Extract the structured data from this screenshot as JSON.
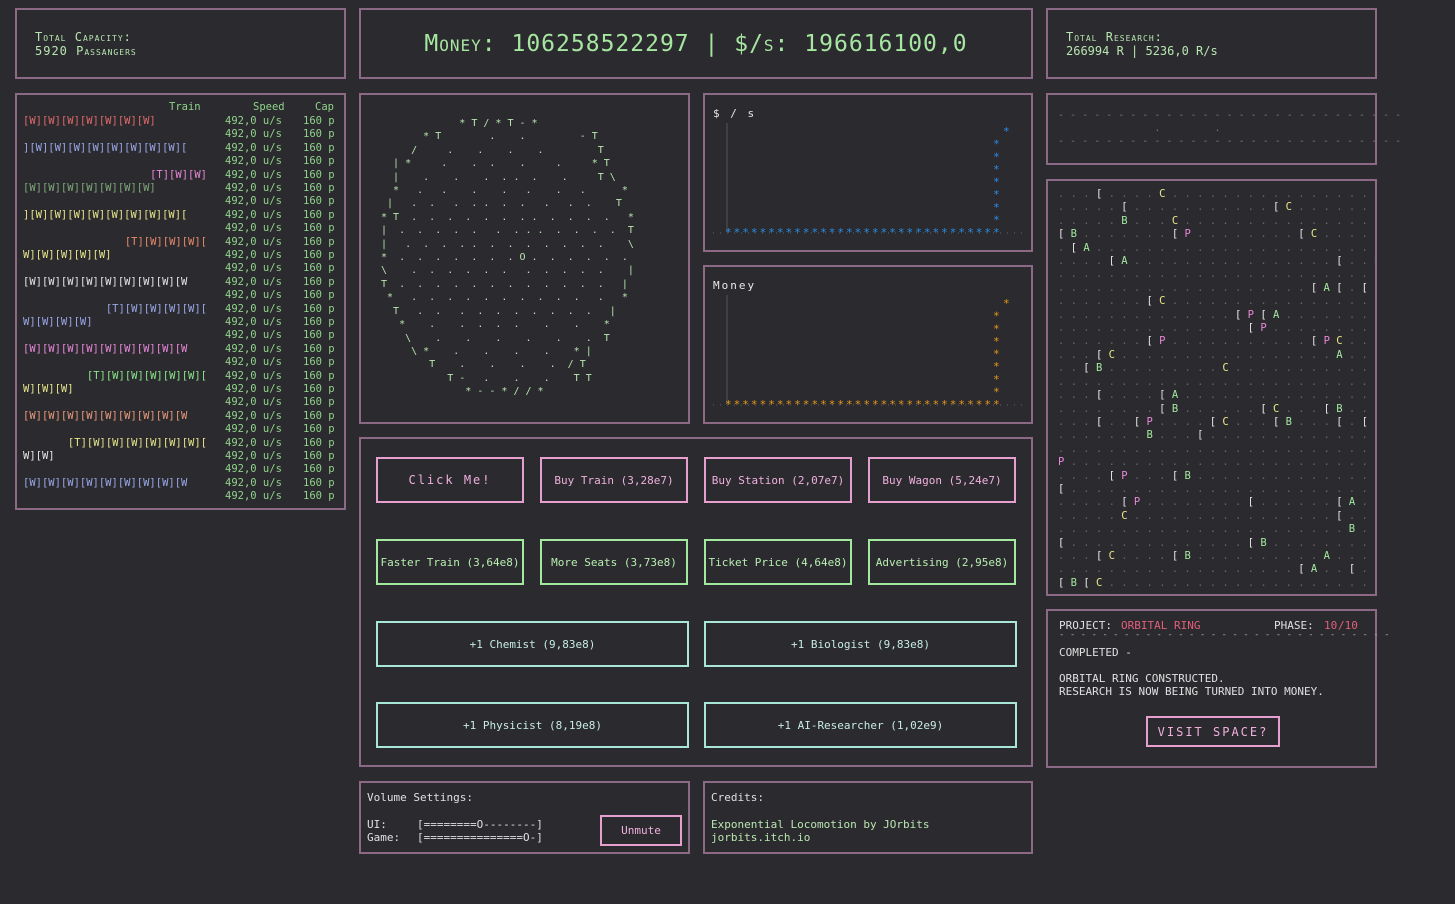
{
  "header": {
    "capacity_label": "Total Capacity:",
    "capacity_value": "5920 Passangers",
    "money_label": "Money:",
    "money_value": "106258522297",
    "separator": "|",
    "rate_label": "$/s:",
    "rate_value": "196616100,0",
    "research_label": "Total Research:",
    "research_value": "266994 R  |  5236,0 R/s"
  },
  "trains": {
    "headers": {
      "train": "Train",
      "speed": "Speed",
      "cap": "Cap"
    },
    "rows": [
      {
        "cars": "[W][W][W][W][W][W][W]",
        "align": "left",
        "color": "#e06a6a"
      },
      {
        "cars": "",
        "color": "#e06a6a"
      },
      {
        "cars": "][W][W][W][W][W][W][W][W][",
        "align": "left",
        "color": "#9aa8e8"
      },
      {
        "cars": "",
        "color": "#9aa8e8"
      },
      {
        "cars": "[T][W][W]",
        "align": "right",
        "color": "#e888d8"
      },
      {
        "cars": "[W][W][W][W][W][W][W]",
        "align": "left",
        "color": "#7ea87a"
      },
      {
        "cars": "",
        "color": "#7ea87a"
      },
      {
        "cars": "][W][W][W][W][W][W][W][W][",
        "align": "left",
        "color": "#e6e68a"
      },
      {
        "cars": "",
        "color": "#e6e68a"
      },
      {
        "cars": "[T][W][W][W][",
        "align": "right",
        "color": "#e88a6a"
      },
      {
        "cars": "W][W][W][W][W]",
        "align": "left",
        "color": "#e6e68a"
      },
      {
        "cars": "",
        "color": "#e6e68a"
      },
      {
        "cars": "[W][W][W][W][W][W][W][W][W",
        "align": "left",
        "color": "#e6e6e6"
      },
      {
        "cars": "",
        "color": "#e6e6e6"
      },
      {
        "cars": "[T][W][W][W][W][",
        "align": "right",
        "color": "#9aa8e8"
      },
      {
        "cars": "W][W][W][W]",
        "align": "left",
        "color": "#9aa8e8"
      },
      {
        "cars": "",
        "color": "#9aa8e8"
      },
      {
        "cars": "[W][W][W][W][W][W][W][W][W",
        "align": "left",
        "color": "#e888d8"
      },
      {
        "cars": "",
        "color": "#e888d8"
      },
      {
        "cars": "[T][W][W][W][W][W][",
        "align": "right",
        "color": "#8ae888"
      },
      {
        "cars": "W][W][W]",
        "align": "left",
        "color": "#e6e68a"
      },
      {
        "cars": "",
        "color": "#e6e68a"
      },
      {
        "cars": "[W][W][W][W][W][W][W][W][W",
        "align": "left",
        "color": "#e89a7a"
      },
      {
        "cars": "",
        "color": "#e89a7a"
      },
      {
        "cars": "[T][W][W][W][W][W][W][",
        "align": "right",
        "color": "#e6e68a"
      },
      {
        "cars": "W][W]",
        "align": "left",
        "color": "#e6e6e6"
      },
      {
        "cars": "",
        "color": "#e6e6e6"
      },
      {
        "cars": "[W][W][W][W][W][W][W][W][W",
        "align": "left",
        "color": "#9aa8e8"
      },
      {
        "cars": "",
        "color": "#9aa8e8"
      }
    ],
    "speed": "492,0 u/s",
    "cap": "160 p"
  },
  "globe": {
    "ascii": "              * T / * T - *\n        * T        .    .         - T\n      /     .    .    .    .         T\n   | *     .    .  .    .     .     * T\n   |    .    .    .  . .  .    .     T \\\n   *   .   .    .    .   .    .   .      *\n  |   .  .   .  . .  .  .   .   .  .    T\n * T  .  .  .  .  .  .  . .  .  .  .  .   *\n |  .  .  .  .  .   .  . . .  .  .  .  .  T\n |   .  .  .  . .  .  .  .  .  .  .  .    \\\n *  .  .  .  .  .  .  . O .  .  .  .  .  .\n \\    .  .  .  .  .  .   .  .  .  .  .    |\n T  .  .  .  .  .  .  .  .  .  .  .  .   |\n  *   .  .  .  .  .  .  .  .  .  .   .   *\n   T   .  .   .  .  .  .  .  .  .  .   |\n    *    .    .  .  .  .    .    .    *\n     \\    .    .    .    .    .    .  T\n      \\ *    .    .    .    .    * |\n         T    .    .    .    .  / T\n            T -   .    .    .    T T\n               * - - * / / *"
  },
  "chart_data": [
    {
      "type": "scatter",
      "title": "$ / s",
      "x": [
        1,
        2,
        3,
        4,
        5,
        6,
        7,
        8,
        9,
        10,
        11,
        12,
        13,
        14,
        15,
        16,
        17,
        18,
        19,
        20,
        21,
        22,
        23,
        24,
        25,
        26,
        27,
        28,
        29,
        30,
        31,
        32
      ],
      "values": [
        0,
        0,
        0,
        0,
        0,
        0,
        0,
        0,
        0,
        0,
        0,
        0,
        0,
        0,
        0,
        0,
        0,
        0,
        0,
        0,
        0,
        0,
        0,
        0,
        0,
        0,
        0,
        0,
        0,
        0,
        0,
        196616100
      ],
      "color": "#2a8fe8"
    },
    {
      "type": "scatter",
      "title": "Money",
      "x": [
        1,
        2,
        3,
        4,
        5,
        6,
        7,
        8,
        9,
        10,
        11,
        12,
        13,
        14,
        15,
        16,
        17,
        18,
        19,
        20,
        21,
        22,
        23,
        24,
        25,
        26,
        27,
        28,
        29,
        30,
        31,
        32
      ],
      "values": [
        0,
        0,
        0,
        0,
        0,
        0,
        0,
        0,
        0,
        0,
        0,
        0,
        0,
        0,
        0,
        0,
        0,
        0,
        0,
        0,
        0,
        0,
        0,
        0,
        0,
        0,
        0,
        0,
        0,
        0,
        0,
        106258522297
      ],
      "color": "#e89a1a"
    }
  ],
  "buttons": {
    "click_me": "Click Me!",
    "buy_train": "Buy Train (3,28e7)",
    "buy_station": "Buy Station (2,07e7)",
    "buy_wagon": "Buy Wagon (5,24e7)",
    "faster_train": "Faster Train (3,64e8)",
    "more_seats": "More Seats (3,73e8)",
    "ticket_price": "Ticket Price (4,64e8)",
    "advertising": "Advertising (2,95e8)",
    "chemist": "+1 Chemist (9,83e8)",
    "biologist": "+1 Biologist (9,83e8)",
    "physicist": "+1 Physicist (8,19e8)",
    "ai_researcher": "+1 AI-Researcher (1,02e9)"
  },
  "volume": {
    "title": "Volume Settings:",
    "ui_label": "UI:",
    "ui_bar": "[========O--------]",
    "game_label": "Game:",
    "game_bar": "[===============O-]",
    "ui_level": 0.47,
    "game_level": 0.94,
    "unmute": "Unmute"
  },
  "credits": {
    "title": "Credits:",
    "line1": "Exponential Locomotion by JOrbits",
    "line2": "jorbits.itch.io"
  },
  "research_strip": {
    "ascii": "- - - - - - - - - - - - - - - - - - - - - - - - - - - - -\n                .         .\n- - - - - - - - - - - - - - - - - - - - - - - - - - - - -"
  },
  "research_grid": {
    "ascii": ". . . [ . . . . C . . . . . . . . . . . . . . . . . . .\n. . . . . [ . . . . . . . . . . . [ C . . . . . . . . .\n. . . . . B . . . C . . . . . . . . . . . . . . . . . .\n[ B . . . . . . . [ P . . . . . . . . [ C . . . . [ . .\n. [ A . . . . . . . . . . . . . . . . . . . . . . . . .\n. . . . [ A . . . . . . . . . . . . . . . . [ . . B . .\n. . . . . . . . . . . . . . . . . . . . . . . . . . . .\n. . . . . . . . . . . . . . . . . . . . [ A [ . [ P . .\n. . . . . . . [ C . . . . . . . . . . . . . . . . . [ B\n. . . . . . . . . . . . . . [ P [ A . . . . . . . . . .\n. . . . . . . . . . . . . . . [ P . . . . . . . . . . .\n. . . . . . . [ P . . . . . . . . . . . [ P C . . . . .\n. . . [ C . . . . . . . . . . . . . . . . . A . . . . .\n. . [ B . . . . . . . . . C . . . . . . . . . . . . . .\n. . . . . . . . . . . . . . . . . . . . . . . . . . A .\n. . . [ . . . . [ A . . . . . . . . . . . . . . . . . .\n. . . . . . . . [ B . . . . . . [ C . . . [ B . . . . .\n. . . [ . . [ P . . . . [ C . . . [ B . . . [ . [ . . .\n. . . . . . . B . . . [ . . . . . . . . . . . . . . . .\n. . . . . . . . . . . . . . . . . . . . . . . . . . . C\nP . . . . . . . . . . . . . . . . . . . . . . . . . [ .\n. . . . [ P . . . [ B . . . . . . . . . . . . . . . . .\n[ . . . . . . . . . . . . . . . . . . . . . . . . . . .\n. . . . . [ P . . . . . . . . [ . . . . . . [ A . . . .\n. . . . . C . . . . . . . . . . . . . . . . [ . . . . .\n. . . . . . . . . . . . . . . . . . . . . . . B . . . .\n[ . . . . . . . . . . . . . . [ B . . . . . . . . . [ .\n. . . [ C . . . . [ B . . . . . . . . . . A . . . . . .\n. . . . . . . . . . . . . . . . . . . [ A . . [ . . . .\n[ B [ C . . . . . . . . . . . . . . . . . . . . . . . ."
  },
  "project": {
    "label": "PROJECT:",
    "name": "ORBITAL RING",
    "phase_label": "PHASE:",
    "phase_current": "10",
    "phase_total": "/10",
    "divider": "- - - - - - - - - - - - - - - - - - - - - - - - - - - - - - -",
    "status": "COMPLETED -",
    "line1": "ORBITAL RING CONSTRUCTED.",
    "line2": "RESEARCH IS NOW BEING TURNED INTO MONEY.",
    "visit": "VISIT SPACE?"
  },
  "colors": {
    "background": "#2b2a2f",
    "border": "#8c6a86",
    "accent_pink": "#f0b0de",
    "accent_green": "#b8e6b0",
    "project_red": "#e0607a"
  }
}
